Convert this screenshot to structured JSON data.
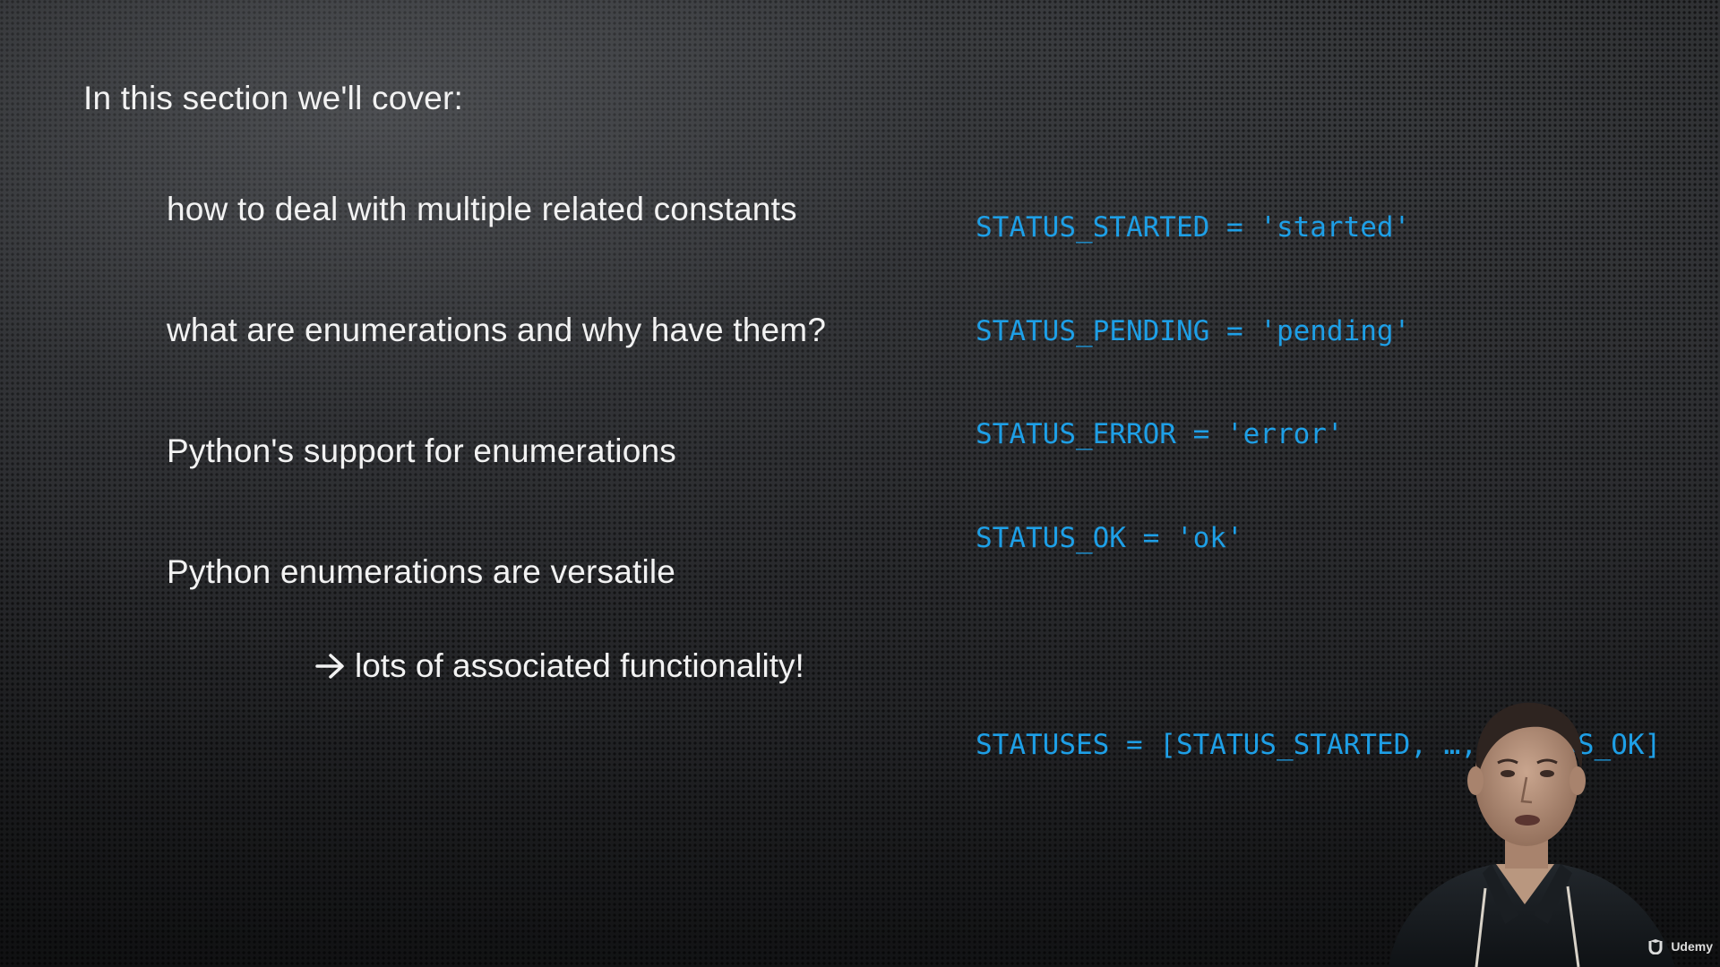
{
  "slide": {
    "heading": "In this section we'll cover:",
    "topics": [
      "how to deal with multiple related constants",
      "what are enumerations and why have them?",
      "Python's support for enumerations",
      "Python enumerations are versatile"
    ],
    "sub_point": {
      "icon": "arrow-right-icon",
      "text": "lots of associated functionality!"
    }
  },
  "code": {
    "lines": [
      "STATUS_STARTED = 'started'",
      "STATUS_PENDING = 'pending'",
      "STATUS_ERROR = 'error'",
      "STATUS_OK = 'ok'",
      "STATUSES = [STATUS_STARTED, …, STATUS_OK]"
    ]
  },
  "watermark": {
    "brand": "Udemy"
  },
  "colors": {
    "background": "#2c2d2f",
    "text": "#f2f2f2",
    "code": "#1e9fe6"
  }
}
